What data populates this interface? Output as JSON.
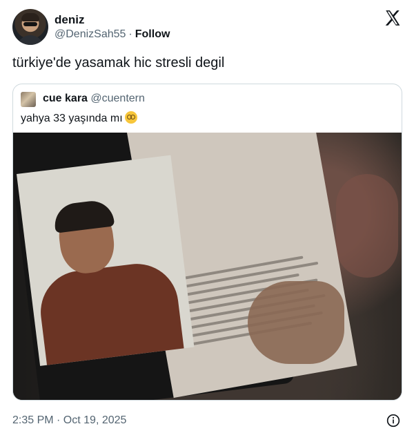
{
  "author": {
    "name": "deniz",
    "handle": "@DenizSah55",
    "separator": "·",
    "follow_label": "Follow"
  },
  "tweet": {
    "text": "türkiye'de yasamak hic stresli degil",
    "timestamp": "2:35 PM · Oct 19, 2025"
  },
  "quoted": {
    "name": "cue kara",
    "handle": "@cuentern",
    "text": "yahya 33 yaşında mı",
    "emoji": "flushed-face-emoji"
  },
  "icons": {
    "brand": "x-logo-icon",
    "info": "info-icon"
  }
}
